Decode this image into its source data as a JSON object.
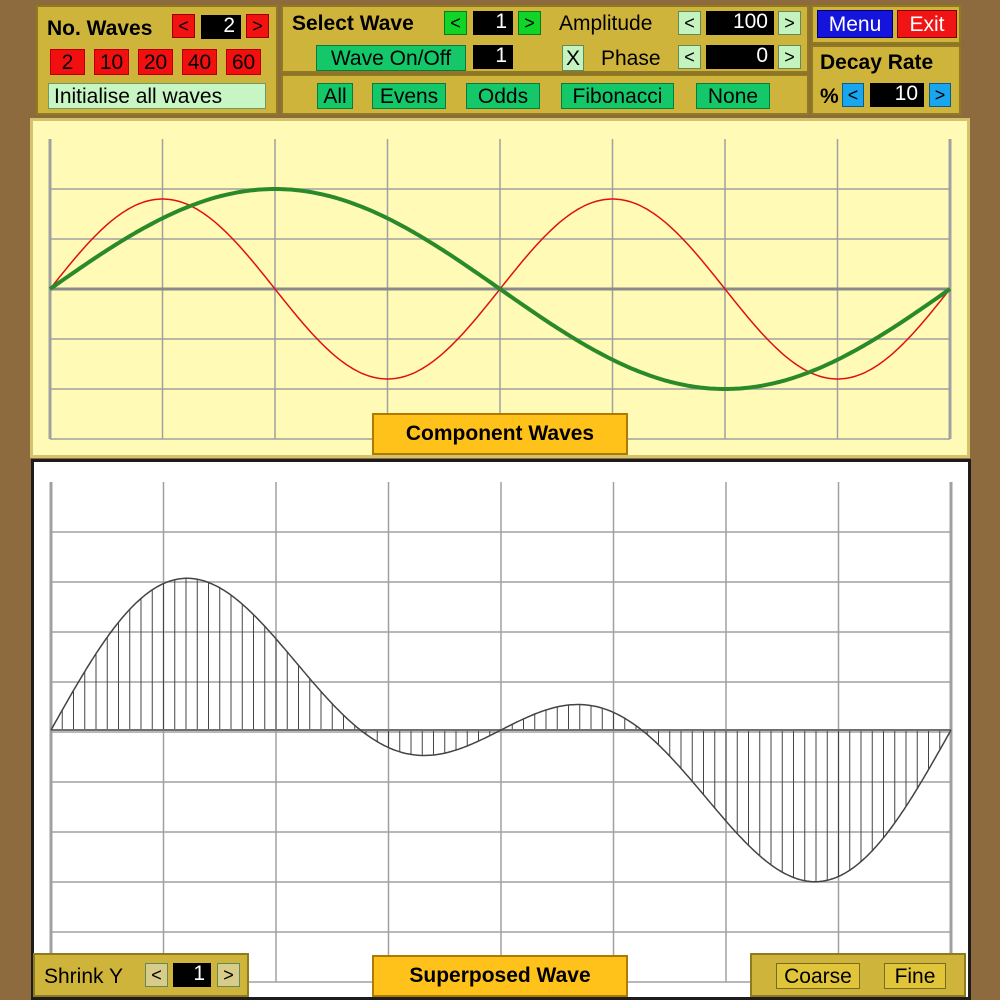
{
  "controls": {
    "num_waves": {
      "label": "No. Waves",
      "value": "2",
      "presets": [
        "2",
        "10",
        "20",
        "40",
        "60"
      ],
      "init_label": "Initialise all waves"
    },
    "select_wave": {
      "label": "Select Wave",
      "value": "1",
      "toggle_label": "Wave On/Off",
      "toggle_value": "1"
    },
    "amplitude": {
      "label": "Amplitude",
      "value": "100"
    },
    "phase": {
      "label": "Phase",
      "value": "0",
      "reset_label": "X"
    },
    "menu_label": "Menu",
    "exit_label": "Exit",
    "decay": {
      "label": "Decay Rate",
      "unit": "%",
      "value": "10"
    },
    "selectors": [
      "All",
      "Evens",
      "Odds",
      "Fibonacci",
      "None"
    ],
    "arrows": {
      "left": "<",
      "right": ">"
    }
  },
  "component_panel": {
    "caption": "Component Waves"
  },
  "superposed_panel": {
    "caption": "Superposed Wave",
    "shrink_label": "Shrink Y",
    "shrink_value": "1",
    "coarse_label": "Coarse",
    "fine_label": "Fine"
  },
  "colors": {
    "wave1": "#2a8a2a",
    "wave2": "#e01010",
    "component_bg": "#fffbb7",
    "superposed_bg": "#ffffff",
    "grid": "#a0a0a0"
  },
  "chart_data": [
    {
      "type": "line",
      "series": [
        {
          "harmonic": 1,
          "amplitude": 100,
          "phase": 0,
          "color": "#2a8a2a"
        },
        {
          "harmonic": 2,
          "amplitude": 90,
          "phase": 0,
          "color": "#e01010"
        }
      ],
      "x": [
        0,
        1
      ],
      "ylim": [
        -150,
        150
      ],
      "grid": true
    },
    {
      "type": "area",
      "series": [
        {
          "formula": "sum of components",
          "amplitude_scale": 1.0
        }
      ],
      "ylim": [
        -250,
        250
      ],
      "grid": true
    }
  ]
}
